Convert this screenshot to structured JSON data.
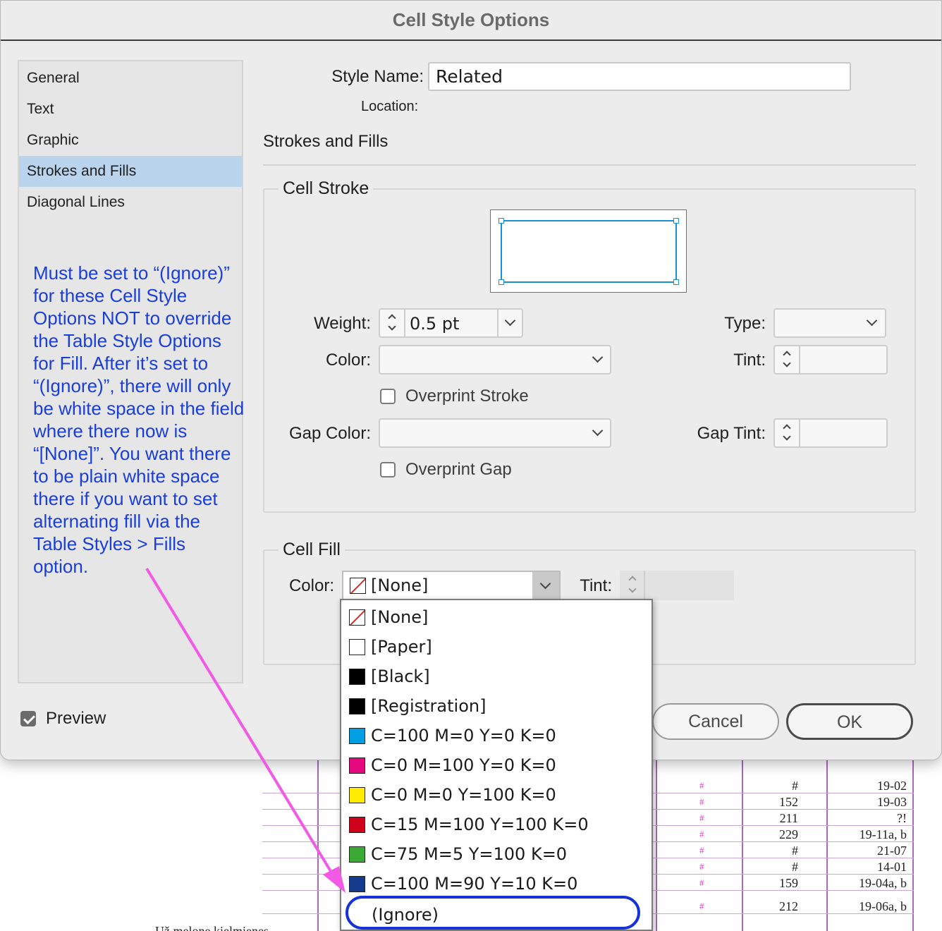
{
  "dialog": {
    "title": "Cell Style Options"
  },
  "sidebar": {
    "items": [
      {
        "label": "General",
        "selected": false
      },
      {
        "label": "Text",
        "selected": false
      },
      {
        "label": "Graphic",
        "selected": false
      },
      {
        "label": "Strokes and Fills",
        "selected": true
      },
      {
        "label": "Diagonal Lines",
        "selected": false
      }
    ],
    "annotation": "Must be set to “(Ignore)” for these Cell Style Options NOT to override the Table Style Options for Fill. After it’s set to “(Ignore)”, there will only be white space in the field where there now is “[None]”. You want there to be plain white space there if you want to set alternating fill via the Table Styles > Fills option."
  },
  "preview": {
    "label": "Preview",
    "checked": true
  },
  "style_name": {
    "label": "Style Name:",
    "value": "Related"
  },
  "location": {
    "label": "Location:"
  },
  "section": {
    "title": "Strokes and Fills"
  },
  "cell_stroke": {
    "title": "Cell Stroke",
    "weight_label": "Weight:",
    "weight_value": "0.5 pt",
    "type_label": "Type:",
    "color_label": "Color:",
    "tint_label": "Tint:",
    "overprint_stroke_label": "Overprint Stroke",
    "gap_color_label": "Gap Color:",
    "gap_tint_label": "Gap Tint:",
    "overprint_gap_label": "Overprint Gap",
    "proxy_color": "#1b8fd6"
  },
  "cell_fill": {
    "title": "Cell Fill",
    "color_label": "Color:",
    "color_value": "[None]",
    "tint_label": "Tint:"
  },
  "buttons": {
    "cancel": "Cancel",
    "ok": "OK"
  },
  "color_menu": {
    "items": [
      {
        "label": "[None]",
        "swatch": "none"
      },
      {
        "label": "[Paper]",
        "swatch": "#ffffff"
      },
      {
        "label": "[Black]",
        "swatch": "#000000"
      },
      {
        "label": "[Registration]",
        "swatch": "#000000"
      },
      {
        "label": "C=100 M=0 Y=0 K=0",
        "swatch": "#009fe3"
      },
      {
        "label": "C=0 M=100 Y=0 K=0",
        "swatch": "#e5097f"
      },
      {
        "label": "C=0 M=0 Y=100 K=0",
        "swatch": "#ffec00"
      },
      {
        "label": "C=15 M=100 Y=100 K=0",
        "swatch": "#d0021b"
      },
      {
        "label": "C=75 M=5 Y=100 K=0",
        "swatch": "#3aa935"
      },
      {
        "label": "C=100 M=90 Y=10 K=0",
        "swatch": "#143a8c"
      },
      {
        "label": "(Ignore)",
        "swatch": "",
        "highlighted": true
      }
    ],
    "highlight_color": "#1533d8",
    "arrow_color": "#f25ae6"
  },
  "background_table": {
    "rows": [
      {
        "col2": "#",
        "col3": "19-02"
      },
      {
        "col2": "152",
        "col3": "19-03"
      },
      {
        "col2": "211",
        "col3": "?!"
      },
      {
        "col2": "229",
        "col3": "19-11a, b"
      },
      {
        "col2": "#",
        "col3": "21-07"
      },
      {
        "col2": "#",
        "col3": "14-01"
      },
      {
        "col2": "159",
        "col3": "19-04a, b"
      },
      {
        "col2": "212",
        "col3": "19-06a, b"
      }
    ],
    "bottom_text": "Už melone kielmienes"
  }
}
